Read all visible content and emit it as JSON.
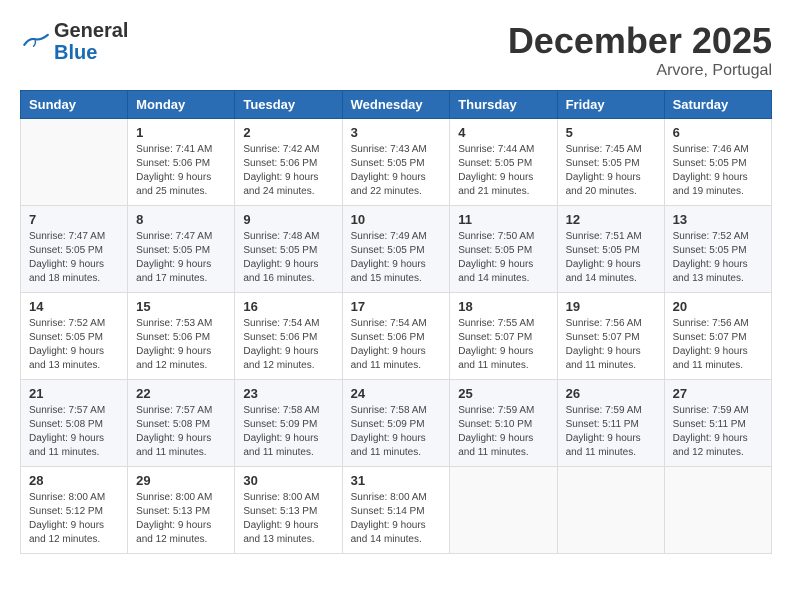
{
  "header": {
    "logo_line1": "General",
    "logo_line2": "Blue",
    "month": "December 2025",
    "location": "Arvore, Portugal"
  },
  "weekdays": [
    "Sunday",
    "Monday",
    "Tuesday",
    "Wednesday",
    "Thursday",
    "Friday",
    "Saturday"
  ],
  "weeks": [
    [
      {
        "day": "",
        "info": ""
      },
      {
        "day": "1",
        "info": "Sunrise: 7:41 AM\nSunset: 5:06 PM\nDaylight: 9 hours\nand 25 minutes."
      },
      {
        "day": "2",
        "info": "Sunrise: 7:42 AM\nSunset: 5:06 PM\nDaylight: 9 hours\nand 24 minutes."
      },
      {
        "day": "3",
        "info": "Sunrise: 7:43 AM\nSunset: 5:05 PM\nDaylight: 9 hours\nand 22 minutes."
      },
      {
        "day": "4",
        "info": "Sunrise: 7:44 AM\nSunset: 5:05 PM\nDaylight: 9 hours\nand 21 minutes."
      },
      {
        "day": "5",
        "info": "Sunrise: 7:45 AM\nSunset: 5:05 PM\nDaylight: 9 hours\nand 20 minutes."
      },
      {
        "day": "6",
        "info": "Sunrise: 7:46 AM\nSunset: 5:05 PM\nDaylight: 9 hours\nand 19 minutes."
      }
    ],
    [
      {
        "day": "7",
        "info": "Sunrise: 7:47 AM\nSunset: 5:05 PM\nDaylight: 9 hours\nand 18 minutes."
      },
      {
        "day": "8",
        "info": "Sunrise: 7:47 AM\nSunset: 5:05 PM\nDaylight: 9 hours\nand 17 minutes."
      },
      {
        "day": "9",
        "info": "Sunrise: 7:48 AM\nSunset: 5:05 PM\nDaylight: 9 hours\nand 16 minutes."
      },
      {
        "day": "10",
        "info": "Sunrise: 7:49 AM\nSunset: 5:05 PM\nDaylight: 9 hours\nand 15 minutes."
      },
      {
        "day": "11",
        "info": "Sunrise: 7:50 AM\nSunset: 5:05 PM\nDaylight: 9 hours\nand 14 minutes."
      },
      {
        "day": "12",
        "info": "Sunrise: 7:51 AM\nSunset: 5:05 PM\nDaylight: 9 hours\nand 14 minutes."
      },
      {
        "day": "13",
        "info": "Sunrise: 7:52 AM\nSunset: 5:05 PM\nDaylight: 9 hours\nand 13 minutes."
      }
    ],
    [
      {
        "day": "14",
        "info": "Sunrise: 7:52 AM\nSunset: 5:05 PM\nDaylight: 9 hours\nand 13 minutes."
      },
      {
        "day": "15",
        "info": "Sunrise: 7:53 AM\nSunset: 5:06 PM\nDaylight: 9 hours\nand 12 minutes."
      },
      {
        "day": "16",
        "info": "Sunrise: 7:54 AM\nSunset: 5:06 PM\nDaylight: 9 hours\nand 12 minutes."
      },
      {
        "day": "17",
        "info": "Sunrise: 7:54 AM\nSunset: 5:06 PM\nDaylight: 9 hours\nand 11 minutes."
      },
      {
        "day": "18",
        "info": "Sunrise: 7:55 AM\nSunset: 5:07 PM\nDaylight: 9 hours\nand 11 minutes."
      },
      {
        "day": "19",
        "info": "Sunrise: 7:56 AM\nSunset: 5:07 PM\nDaylight: 9 hours\nand 11 minutes."
      },
      {
        "day": "20",
        "info": "Sunrise: 7:56 AM\nSunset: 5:07 PM\nDaylight: 9 hours\nand 11 minutes."
      }
    ],
    [
      {
        "day": "21",
        "info": "Sunrise: 7:57 AM\nSunset: 5:08 PM\nDaylight: 9 hours\nand 11 minutes."
      },
      {
        "day": "22",
        "info": "Sunrise: 7:57 AM\nSunset: 5:08 PM\nDaylight: 9 hours\nand 11 minutes."
      },
      {
        "day": "23",
        "info": "Sunrise: 7:58 AM\nSunset: 5:09 PM\nDaylight: 9 hours\nand 11 minutes."
      },
      {
        "day": "24",
        "info": "Sunrise: 7:58 AM\nSunset: 5:09 PM\nDaylight: 9 hours\nand 11 minutes."
      },
      {
        "day": "25",
        "info": "Sunrise: 7:59 AM\nSunset: 5:10 PM\nDaylight: 9 hours\nand 11 minutes."
      },
      {
        "day": "26",
        "info": "Sunrise: 7:59 AM\nSunset: 5:11 PM\nDaylight: 9 hours\nand 11 minutes."
      },
      {
        "day": "27",
        "info": "Sunrise: 7:59 AM\nSunset: 5:11 PM\nDaylight: 9 hours\nand 12 minutes."
      }
    ],
    [
      {
        "day": "28",
        "info": "Sunrise: 8:00 AM\nSunset: 5:12 PM\nDaylight: 9 hours\nand 12 minutes."
      },
      {
        "day": "29",
        "info": "Sunrise: 8:00 AM\nSunset: 5:13 PM\nDaylight: 9 hours\nand 12 minutes."
      },
      {
        "day": "30",
        "info": "Sunrise: 8:00 AM\nSunset: 5:13 PM\nDaylight: 9 hours\nand 13 minutes."
      },
      {
        "day": "31",
        "info": "Sunrise: 8:00 AM\nSunset: 5:14 PM\nDaylight: 9 hours\nand 14 minutes."
      },
      {
        "day": "",
        "info": ""
      },
      {
        "day": "",
        "info": ""
      },
      {
        "day": "",
        "info": ""
      }
    ]
  ]
}
